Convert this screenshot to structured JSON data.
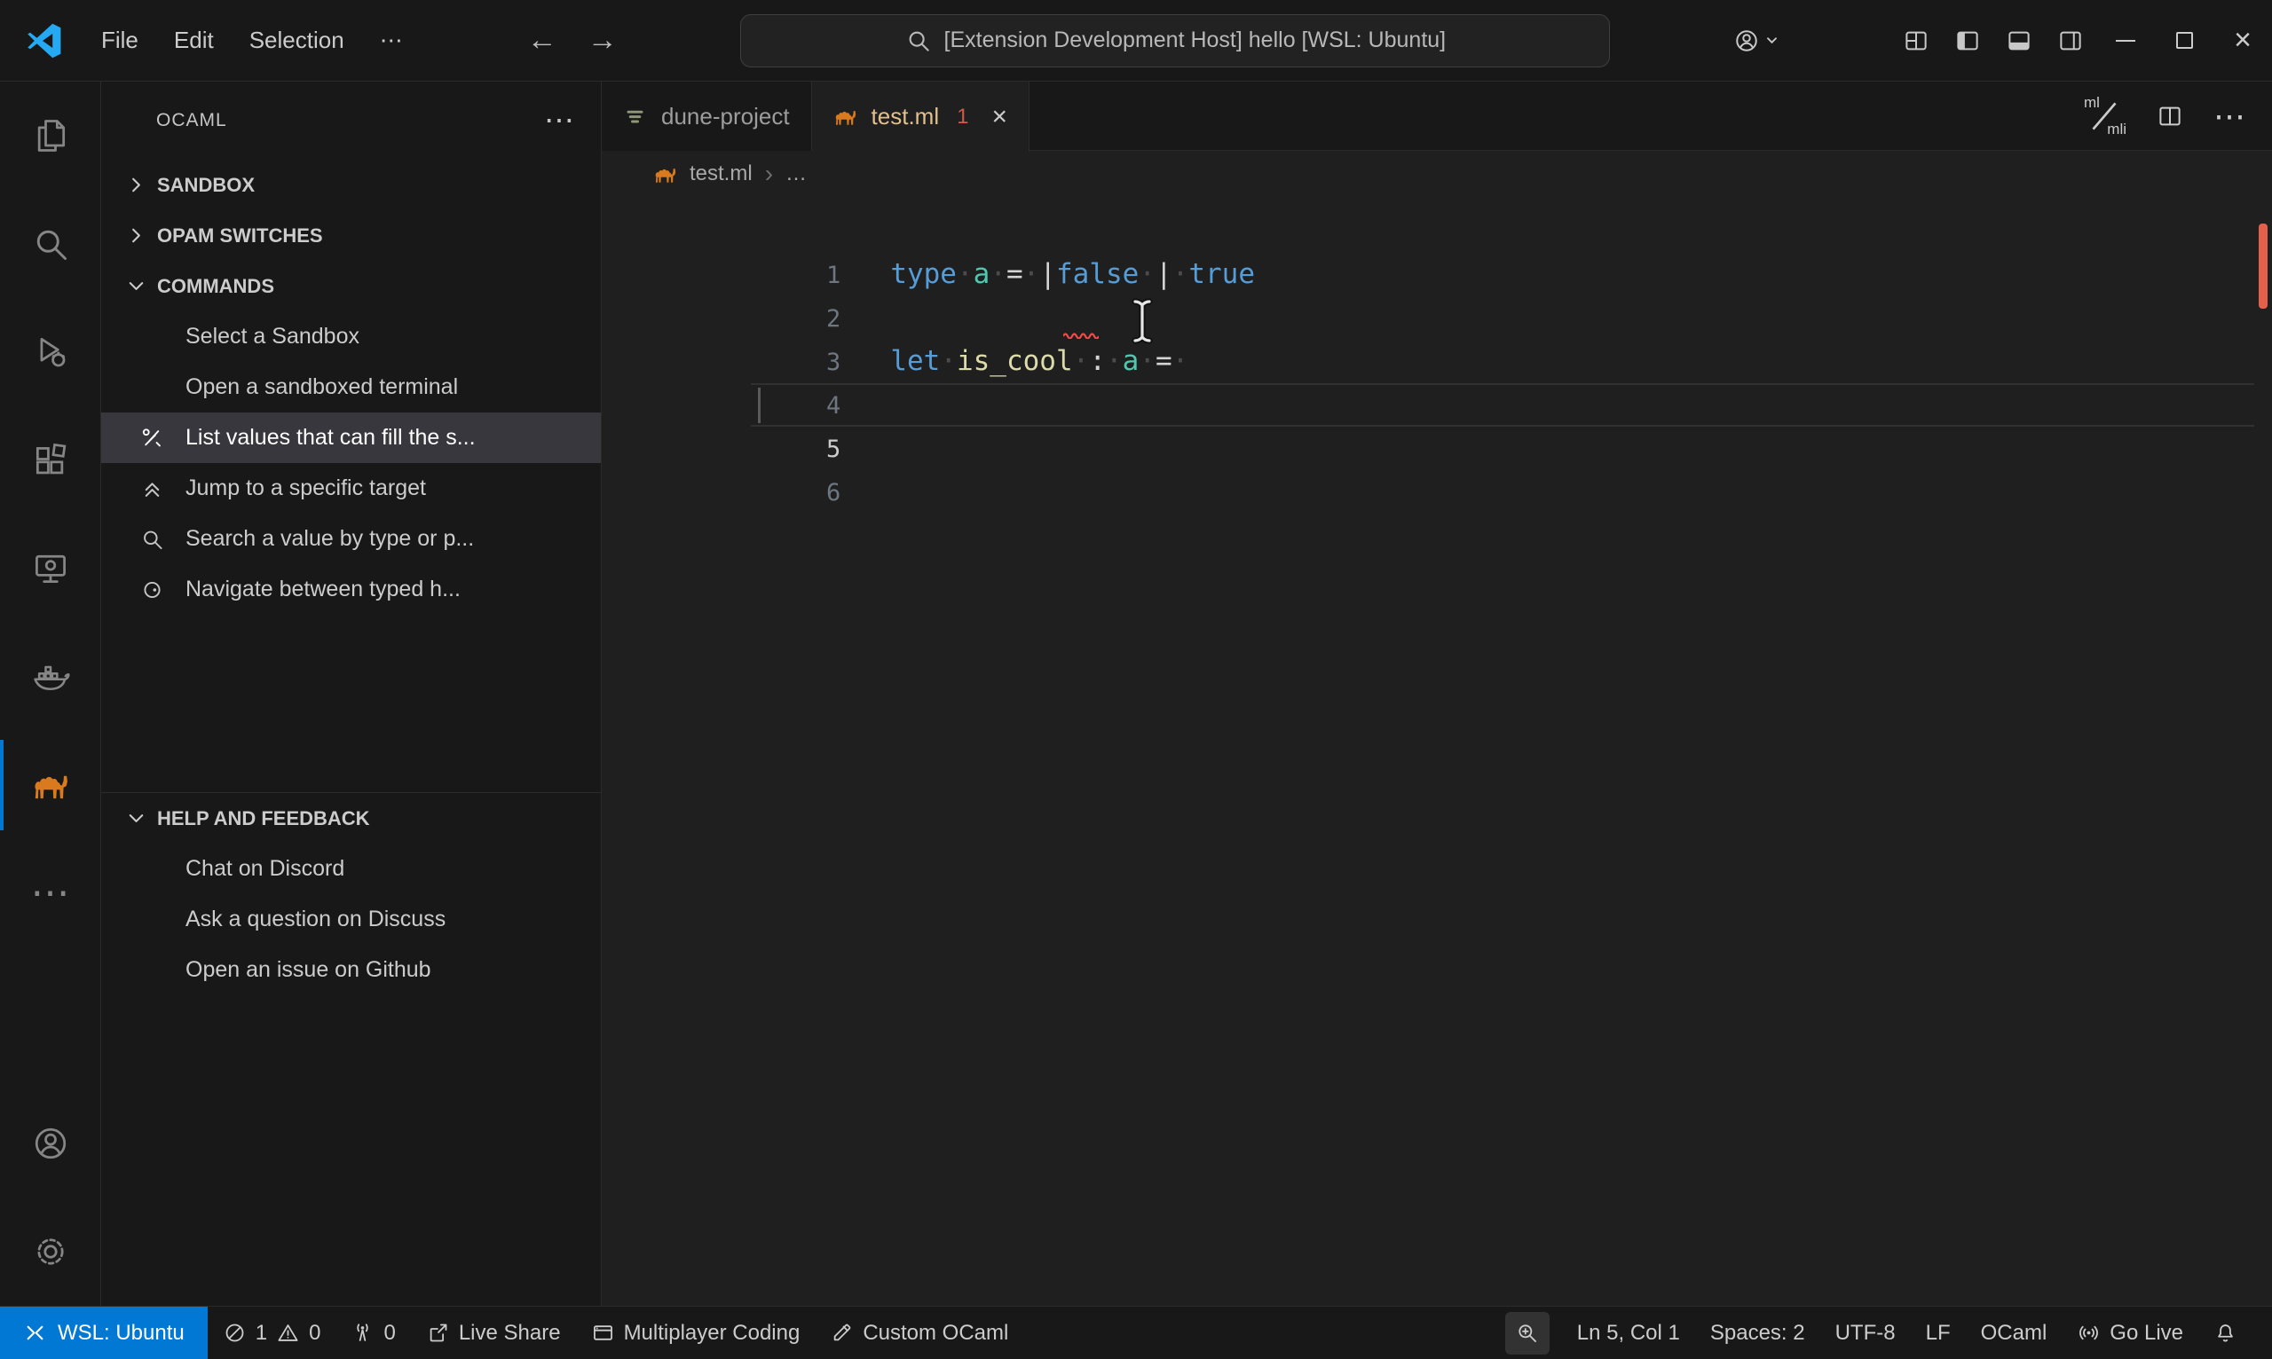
{
  "palette": {
    "bg_editor": "#1F1F1F",
    "bg_panel": "#181818",
    "border": "#2B2B2B",
    "accent_blue": "#0078D4",
    "remote_bg": "#0078D4",
    "error_red": "#F14C4C",
    "camel_orange": "#D97A1F",
    "keyword_blue": "#569CD6",
    "type_teal": "#4EC9B0",
    "name_cream": "#DCDCAA",
    "punct_white": "#D4D4D4",
    "tab_label_modified": "#E2C08D",
    "selected_row": "#37373D"
  },
  "glyphs": {
    "more_h": "⋯",
    "back": "←",
    "forward": "→",
    "close_tab": "×",
    "close_window": "×",
    "breadcrumb_sep": "›",
    "breadcrumb_more": "…"
  },
  "title_bar": {
    "menus": [
      "File",
      "Edit",
      "Selection"
    ],
    "command_center": "[Extension Development Host] hello [WSL: Ubuntu]"
  },
  "sidebar": {
    "title": "OCAML",
    "sections": [
      {
        "label": "SANDBOX"
      },
      {
        "label": "OPAM SWITCHES"
      },
      {
        "label": "COMMANDS",
        "items": [
          "Select a Sandbox",
          "Open a sandboxed terminal",
          "List values that can fill the s...",
          "Jump to a specific target",
          "Search a value by type or p...",
          "Navigate between typed h..."
        ]
      },
      {
        "label": "HELP AND FEEDBACK",
        "items": [
          "Chat on Discord",
          "Ask a question on Discuss",
          "Open an issue on Github"
        ]
      }
    ]
  },
  "tabs": [
    {
      "label": "dune-project"
    },
    {
      "label": "test.ml",
      "badge": "1"
    }
  ],
  "breadcrumb": {
    "file": "test.ml"
  },
  "editor_actions": {
    "mli_top": "ml",
    "mli_bottom": "mli"
  },
  "editor": {
    "lines": [
      {
        "num": "1",
        "tokens": [
          {
            "t": "type"
          },
          {
            "t": "·"
          },
          {
            "t": "a"
          },
          {
            "t": "·"
          },
          {
            "t": "="
          },
          {
            "t": "·"
          },
          {
            "t": "|"
          },
          {
            "t": "false"
          },
          {
            "t": "·"
          },
          {
            "t": "|"
          },
          {
            "t": "·"
          },
          {
            "t": "true"
          }
        ]
      },
      {
        "num": "2",
        "tokens": []
      },
      {
        "num": "3",
        "tokens": [
          {
            "t": "let"
          },
          {
            "t": "·"
          },
          {
            "t": "is_cool"
          },
          {
            "t": "·"
          },
          {
            "t": ":"
          },
          {
            "t": "·"
          },
          {
            "t": "a"
          },
          {
            "t": "·"
          },
          {
            "t": "="
          },
          {
            "t": "·"
          }
        ]
      },
      {
        "num": "4",
        "tokens": []
      },
      {
        "num": "5",
        "tokens": []
      },
      {
        "num": "6",
        "tokens": []
      }
    ]
  },
  "status_bar": {
    "remote_label": "WSL: Ubuntu",
    "errors": "1",
    "warnings": "0",
    "ports": "0",
    "live_share": "Live Share",
    "multiplayer": "Multiplayer Coding",
    "custom_ocaml": "Custom OCaml",
    "line_col": "Ln 5, Col 1",
    "spaces": "Spaces: 2",
    "encoding": "UTF-8",
    "eol": "LF",
    "language": "OCaml",
    "go_live": "Go Live"
  }
}
